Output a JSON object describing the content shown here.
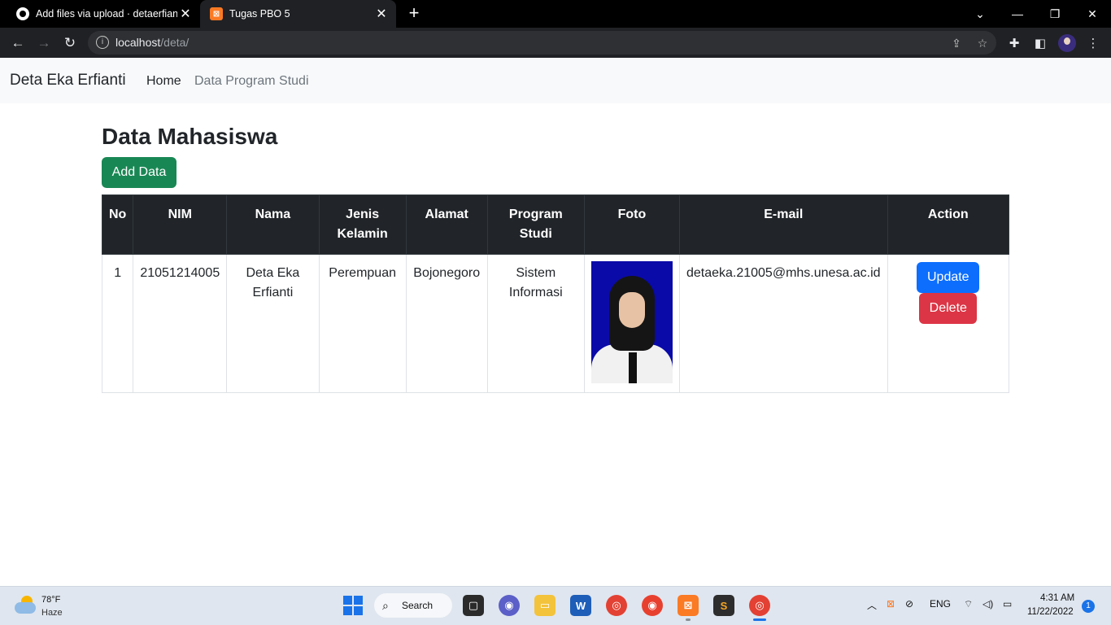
{
  "browser": {
    "tabs": [
      {
        "title": "Add files via upload · detaerfianti",
        "icon": "github-icon",
        "active": false
      },
      {
        "title": "Tugas PBO 5",
        "icon": "xampp-icon",
        "active": true
      }
    ],
    "url_host": "localhost",
    "url_path": "/deta/"
  },
  "navbar": {
    "brand": "Deta Eka Erfianti",
    "links": [
      "Home",
      "Data Program Studi"
    ]
  },
  "page": {
    "title": "Data Mahasiswa",
    "add_button": "Add Data"
  },
  "table": {
    "headers": [
      "No",
      "NIM",
      "Nama",
      "Jenis Kelamin",
      "Alamat",
      "Program Studi",
      "Foto",
      "E-mail",
      "Action"
    ],
    "rows": [
      {
        "no": "1",
        "nim": "21051214005",
        "nama": "Deta Eka Erfianti",
        "jenis_kelamin": "Perempuan",
        "alamat": "Bojonegoro",
        "program_studi": "Sistem Informasi",
        "email": "detaeka.21005@mhs.unesa.ac.id",
        "update_label": "Update",
        "delete_label": "Delete"
      }
    ]
  },
  "taskbar": {
    "weather_temp": "78°F",
    "weather_desc": "Haze",
    "search_label": "Search",
    "language": "ENG",
    "time": "4:31 AM",
    "date": "11/22/2022",
    "notification_count": "1"
  },
  "colors": {
    "success": "#198754",
    "primary": "#0d6efd",
    "danger": "#dc3545",
    "table_header": "#212529"
  }
}
